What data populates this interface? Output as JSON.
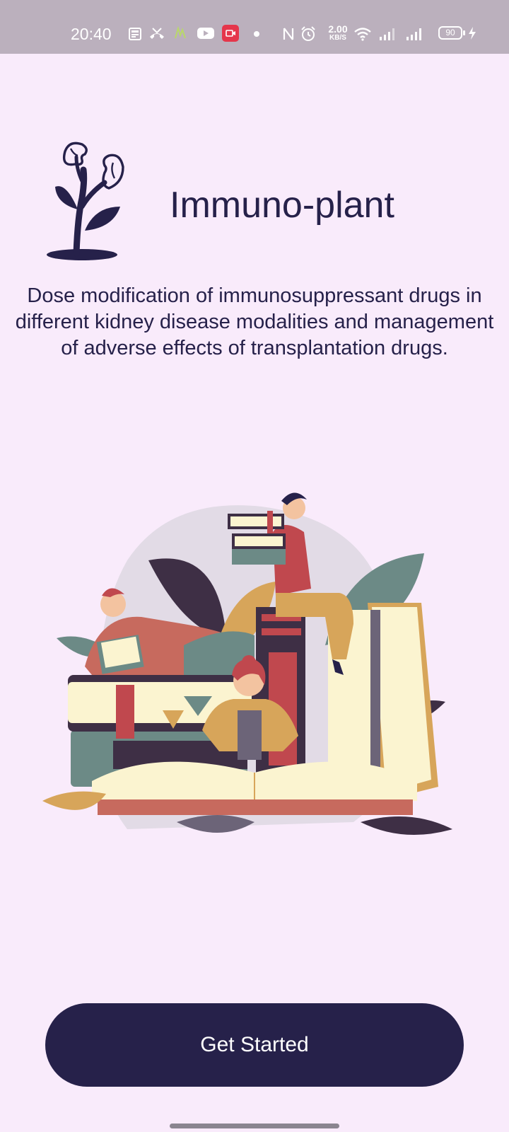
{
  "status_bar": {
    "time": "20:40",
    "net_speed_value": "2.00",
    "net_speed_unit": "KB/S",
    "battery_level": "90",
    "icons": [
      "news-icon",
      "missed-call-icon",
      "app-icon",
      "youtube-icon",
      "screen-record-icon",
      "dot-icon",
      "nfc-icon",
      "alarm-icon",
      "wifi-icon",
      "signal-icon",
      "signal-icon",
      "battery-icon",
      "charging-icon"
    ]
  },
  "app": {
    "title": "Immuno-plant",
    "description": "Dose modification of immunosuppressant drugs in different kidney disease modalities and management of adverse effects of transplantation drugs."
  },
  "actions": {
    "get_started_label": "Get Started"
  },
  "colors": {
    "background": "#f9ebfb",
    "primary": "#26214a",
    "status_bar": "#bbb0bd"
  }
}
